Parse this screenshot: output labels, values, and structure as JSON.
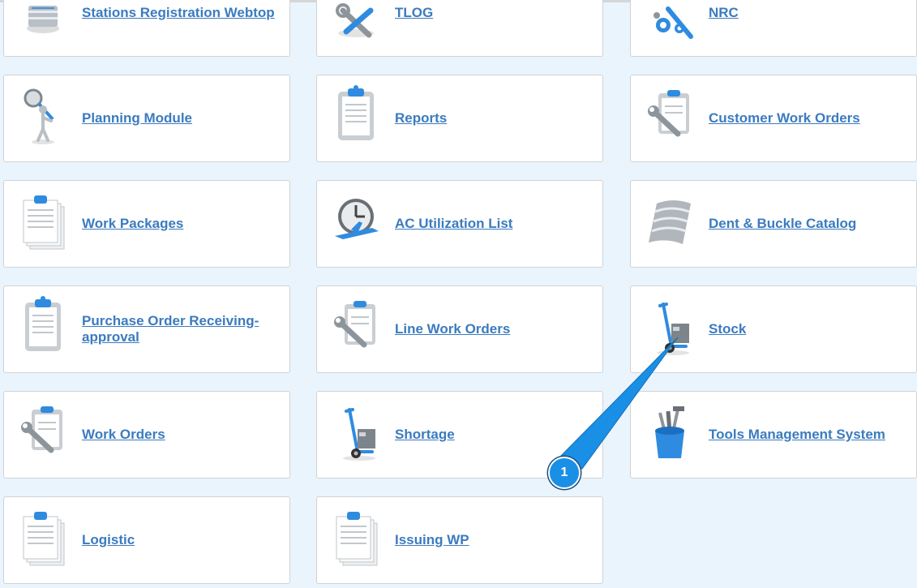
{
  "tiles": [
    {
      "label": "Stations Registration Webtop",
      "icon": "server-stack-icon"
    },
    {
      "label": "TLOG",
      "icon": "tools-icon"
    },
    {
      "label": "NRC",
      "icon": "gears-wrench-icon"
    },
    {
      "label": "Planning Module",
      "icon": "magnifier-figure-icon"
    },
    {
      "label": "Reports",
      "icon": "clipboard-icon"
    },
    {
      "label": "Customer Work Orders",
      "icon": "clipboard-wrench-icon"
    },
    {
      "label": "Work Packages",
      "icon": "document-stack-icon"
    },
    {
      "label": "AC Utilization List",
      "icon": "clock-airplane-icon"
    },
    {
      "label": "Dent & Buckle Catalog",
      "icon": "metal-panel-icon"
    },
    {
      "label": "Purchase Order Receiving-approval",
      "icon": "clipboard-icon"
    },
    {
      "label": "Line Work Orders",
      "icon": "clipboard-wrench-icon"
    },
    {
      "label": "Stock",
      "icon": "hand-truck-icon"
    },
    {
      "label": "Work Orders",
      "icon": "clipboard-wrench-icon"
    },
    {
      "label": "Shortage",
      "icon": "hand-truck-icon"
    },
    {
      "label": "Tools Management System",
      "icon": "tool-bucket-icon"
    },
    {
      "label": "Logistic",
      "icon": "document-stack-icon"
    },
    {
      "label": "Issuing WP",
      "icon": "document-stack-icon"
    }
  ],
  "callout": {
    "number": "1"
  },
  "colors": {
    "link": "#3b7bbf",
    "background": "#eaf4fc",
    "callout": "#1a8fe6"
  }
}
